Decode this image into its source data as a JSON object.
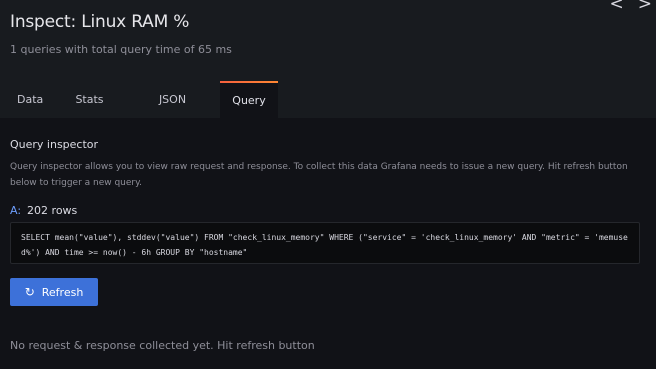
{
  "header": {
    "title": "Inspect: Linux RAM %",
    "subtitle": "1 queries with total query time of 65 ms"
  },
  "nav": {
    "prev_icon": "<",
    "next_icon": ">"
  },
  "tabs": [
    {
      "label": "Data",
      "active": false
    },
    {
      "label": "Stats",
      "active": false
    },
    {
      "label": "JSON",
      "active": false
    },
    {
      "label": "Query",
      "active": true
    }
  ],
  "query_inspector": {
    "title": "Query inspector",
    "description": "Query inspector allows you to view raw request and response. To collect this data Grafana needs to issue a new query. Hit refresh button below to trigger a new query.",
    "query_letter": "A:",
    "rows_label": "202 rows",
    "sql": "SELECT mean(\"value\"), stddev(\"value\") FROM \"check_linux_memory\" WHERE (\"service\" = 'check_linux_memory' AND \"metric\" = 'memused%') AND time >= now() - 6h GROUP BY \"hostname\"",
    "refresh_label": "Refresh",
    "refresh_icon": "↻",
    "status": "No request & response collected yet. Hit refresh button"
  },
  "colors": {
    "accent": "#3d71d9",
    "tab_active_border": "#f55f3e",
    "background": "#111217",
    "header_bg": "#181b1f"
  }
}
